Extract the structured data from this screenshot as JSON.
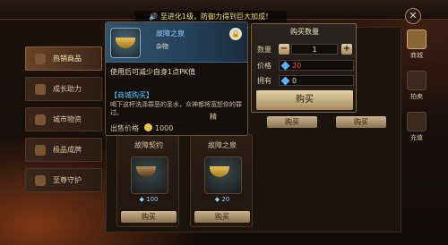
{
  "notice": {
    "text": "至进化1级，防御力得到巨大加成！"
  },
  "sidebar": {
    "items": [
      {
        "label": "热销商品"
      },
      {
        "label": "成长助力"
      },
      {
        "label": "城市物资"
      },
      {
        "label": "极品成牌"
      },
      {
        "label": "至尊守护"
      }
    ]
  },
  "shop_cards": [
    {
      "name": "故障契约",
      "price": "100",
      "buy": "购买"
    },
    {
      "name": "故障之泉",
      "price": "20",
      "buy": "购买"
    }
  ],
  "list_buy_buttons": [
    "购买",
    "购买"
  ],
  "right_tabs": [
    {
      "label": "商城"
    },
    {
      "label": "拍卖"
    },
    {
      "label": "充值"
    }
  ],
  "tooltip": {
    "name": "故障之泉",
    "type": "杂物",
    "description": "使用后可减少自身1点PK值",
    "section": "【商城购买】",
    "text": "喝下这杯洗涤罪恶的圣水，众神都将宽恕你的罪过。",
    "price_label": "出售价格",
    "price": "1000",
    "partial_label": "精"
  },
  "buy_panel": {
    "title": "购买数量",
    "qty_label": "数量",
    "qty": "1",
    "price_label": "价格",
    "price": "20",
    "own_label": "拥有",
    "own": "0",
    "buy": "购买",
    "minus": "−",
    "plus": "+"
  },
  "colors": {
    "price_red": "#ff4a3a",
    "accent_blue": "#56d0ff"
  }
}
